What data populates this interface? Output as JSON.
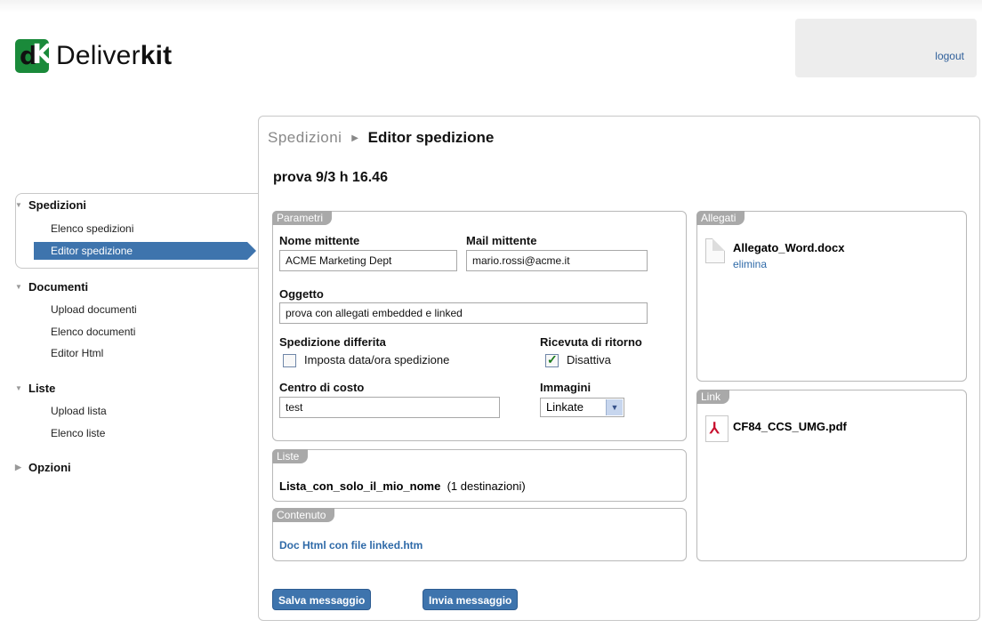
{
  "brand": {
    "logo_mark": "dK",
    "name_regular": "Deliver",
    "name_bold": "kit"
  },
  "header": {
    "logout_label": "logout"
  },
  "sidebar": {
    "sections": [
      {
        "label": "Spedizioni",
        "expanded": true,
        "items": [
          "Elenco spedizioni",
          "Editor spedizione"
        ]
      },
      {
        "label": "Documenti",
        "expanded": true,
        "items": [
          "Upload documenti",
          "Elenco documenti",
          "Editor Html"
        ]
      },
      {
        "label": "Liste",
        "expanded": true,
        "items": [
          "Upload lista",
          "Elenco liste"
        ]
      },
      {
        "label": "Opzioni",
        "expanded": false,
        "items": []
      }
    ],
    "active_item": "Editor spedizione"
  },
  "breadcrumb": {
    "parent": "Spedizioni",
    "current": "Editor spedizione"
  },
  "shipment_title": "prova 9/3 h 16.46",
  "parametri": {
    "tab": "Parametri",
    "sender_name_label": "Nome mittente",
    "sender_name_value": "ACME Marketing Dept",
    "sender_mail_label": "Mail mittente",
    "sender_mail_value": "mario.rossi@acme.it",
    "subject_label": "Oggetto",
    "subject_value": "prova con allegati embedded e linked",
    "deferred_label": "Spedizione differita",
    "deferred_checkbox_label": "Imposta data/ora spedizione",
    "deferred_checked": false,
    "receipt_label": "Ricevuta di ritorno",
    "receipt_checkbox_label": "Disattiva",
    "receipt_checked": true,
    "cost_center_label": "Centro di costo",
    "cost_center_value": "test",
    "images_label": "Immagini",
    "images_value": "Linkate"
  },
  "liste": {
    "tab": "Liste",
    "list_name": "Lista_con_solo_il_mio_nome",
    "recipients": "(1 destinazioni)"
  },
  "contenuto": {
    "tab": "Contenuto",
    "document": "Doc Html con file linked.htm"
  },
  "allegati": {
    "tab": "Allegati",
    "file_name": "Allegato_Word.docx",
    "delete_label": "elimina"
  },
  "link": {
    "tab": "Link",
    "file_name": "CF84_CCS_UMG.pdf"
  },
  "actions": {
    "save_label": "Salva messaggio",
    "send_label": "Invia messaggio"
  },
  "colors": {
    "accent": "#3e74ad",
    "tab_gray": "#a9a9a9",
    "logo_green": "#1a8a3a",
    "link": "#2f6aa8"
  }
}
